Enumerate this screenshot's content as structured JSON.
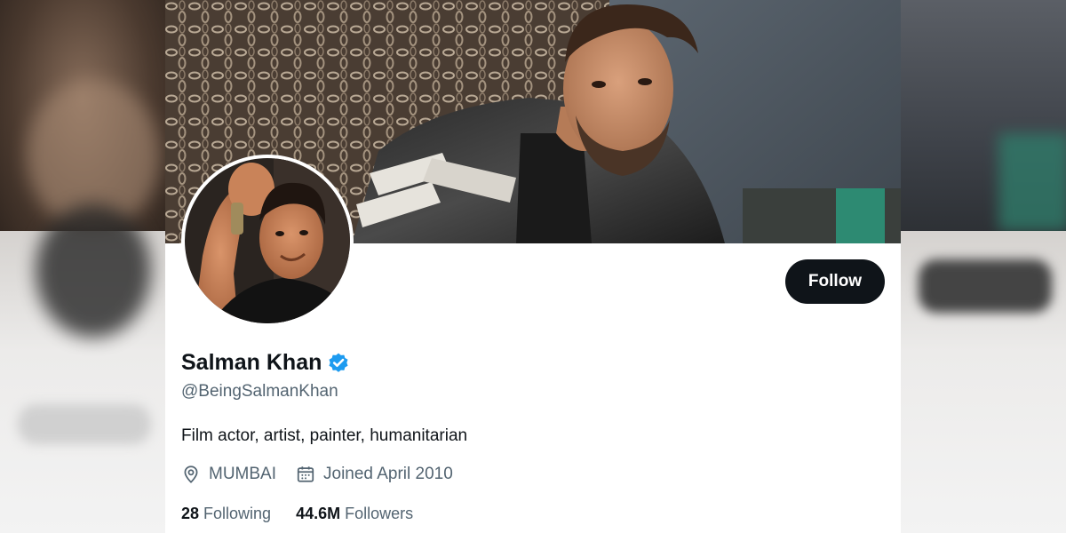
{
  "profile": {
    "display_name": "Salman Khan",
    "verified": true,
    "handle": "@BeingSalmanKhan",
    "bio": "Film actor, artist, painter, humanitarian",
    "location": "MUMBAI",
    "joined": "Joined April 2010",
    "following_count": "28",
    "following_label": "Following",
    "followers_count": "44.6M",
    "followers_label": "Followers"
  },
  "actions": {
    "follow_label": "Follow"
  },
  "icons": {
    "verified": "verified-badge-icon",
    "location": "location-pin-icon",
    "calendar": "calendar-icon"
  },
  "colors": {
    "primary_text": "#0f1419",
    "secondary_text": "#536471",
    "verified_blue": "#1d9bf0",
    "follow_button_bg": "#0f1419"
  }
}
